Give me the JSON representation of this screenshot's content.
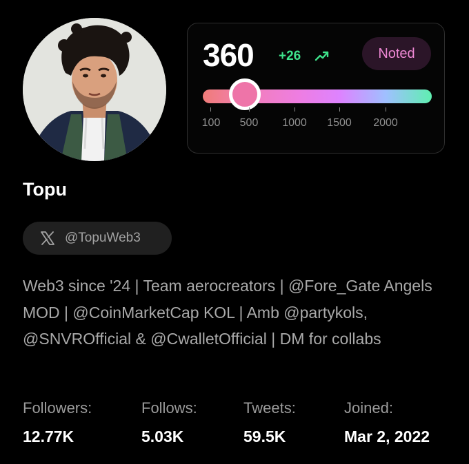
{
  "profile": {
    "name": "Topu",
    "handle": "@TopuWeb3",
    "bio": "Web3 since '24 | Team aerocreators | @Fore_Gate Angels MOD | @CoinMarketCap KOL | Amb @partykols, @SNVROfficial & @CwalletOfficial | DM for collabs"
  },
  "score": {
    "value": "360",
    "delta": "+26",
    "badge": "Noted",
    "ticks": [
      "100",
      "500",
      "1000",
      "1500",
      "2000"
    ],
    "level_on_scale": 360
  },
  "stats": [
    {
      "label": "Followers:",
      "value": "12.77K"
    },
    {
      "label": "Follows:",
      "value": "5.03K"
    },
    {
      "label": "Tweets:",
      "value": "59.5K"
    },
    {
      "label": "Joined:",
      "value": "Mar 2, 2022"
    }
  ],
  "icons": {
    "trend": "trending-up-icon",
    "x_logo": "x-logo-icon"
  },
  "colors": {
    "background": "#000000",
    "delta_green": "#3ee28b",
    "badge_pink": "#ee88d4",
    "thumb_pink": "#ee74a8"
  }
}
